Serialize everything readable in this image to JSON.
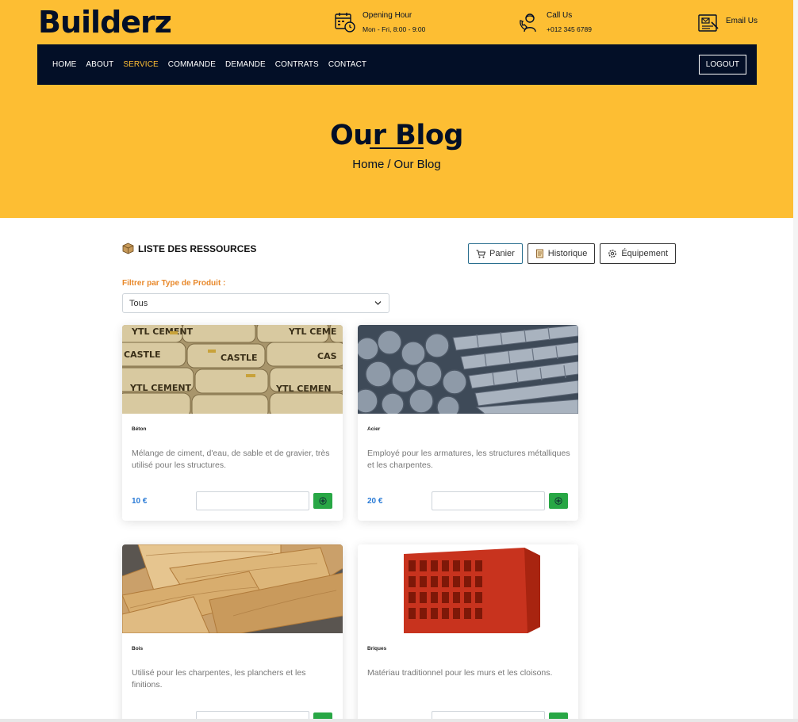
{
  "brand": "Builderz",
  "topbar": {
    "opening": {
      "title": "Opening Hour",
      "value": "Mon - Fri, 8:00 - 9:00",
      "icon": "calendar-clock-icon"
    },
    "call": {
      "title": "Call Us",
      "value": "+012 345 6789",
      "icon": "phone-support-icon"
    },
    "email": {
      "title": "Email Us",
      "icon": "email-icon"
    }
  },
  "nav": {
    "items": [
      {
        "label": "HOME"
      },
      {
        "label": "ABOUT"
      },
      {
        "label": "SERVICE"
      },
      {
        "label": "COMMANDE"
      },
      {
        "label": "DEMANDE"
      },
      {
        "label": "CONTRATS"
      },
      {
        "label": "CONTACT"
      }
    ],
    "active": "SERVICE",
    "logout": "LOGOUT"
  },
  "hero": {
    "title": "Our Blog",
    "crumb_home": "Home",
    "crumb_sep": "/",
    "crumb_current": "Our Blog"
  },
  "resources": {
    "title": "LISTE DES RESSOURCES",
    "actions": {
      "panier": "Panier",
      "historique": "Historique",
      "equipement": "Équipement"
    },
    "filter_label": "Filtrer par Type de Produit :",
    "filter_value": "Tous"
  },
  "products": [
    {
      "name": "Béton",
      "desc": "Mélange de ciment, d'eau, de sable et de gravier, très utilisé pour les structures.",
      "price": "10 €",
      "image": "cement-bags"
    },
    {
      "name": "Acier",
      "desc": "Employé pour les armatures, les structures métalliques et les charpentes.",
      "price": "20 €",
      "image": "steel-rebar"
    },
    {
      "name": "Bois",
      "desc": "Utilisé pour les charpentes, les planchers et les finitions.",
      "price": "",
      "image": "wood-planks"
    },
    {
      "name": "Briques",
      "desc": "Matériau traditionnel pour les murs et les cloisons.",
      "price": "",
      "image": "red-brick"
    }
  ],
  "colors": {
    "accent": "#fdbe33",
    "navy": "#030f27",
    "orange_label": "#e8882a",
    "price_blue": "#2a7bd6",
    "add_green": "#28a745"
  }
}
